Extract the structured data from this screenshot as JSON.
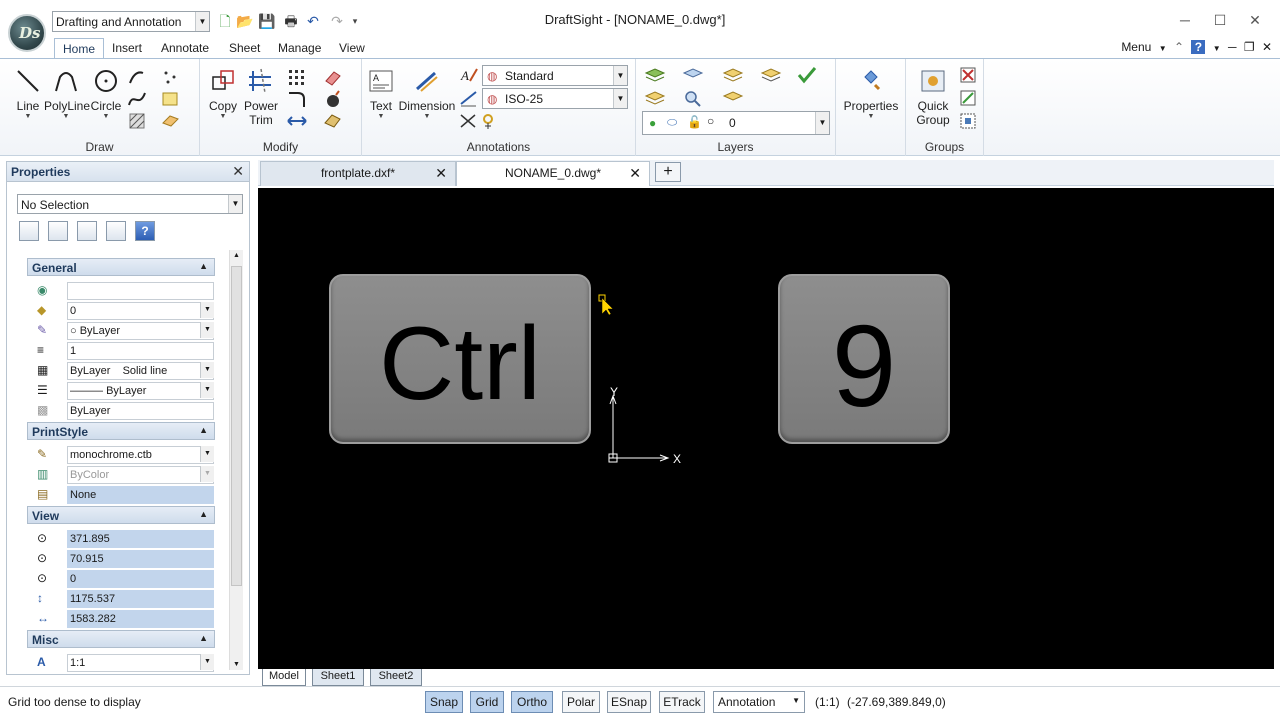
{
  "app": {
    "logo_text": "Ds",
    "title": "DraftSight - [NONAME_0.dwg*]"
  },
  "workspace": {
    "value": "Drafting and Annotation"
  },
  "ribbon_tabs": [
    "Home",
    "Insert",
    "Annotate",
    "Sheet",
    "Manage",
    "View"
  ],
  "menu_label": "Menu",
  "draw": {
    "group": "Draw",
    "line": "Line",
    "polyline": "PolyLine",
    "circle": "Circle"
  },
  "modify": {
    "group": "Modify",
    "copy": "Copy",
    "power": "Power",
    "trim": "Trim"
  },
  "annotations": {
    "group": "Annotations",
    "text": "Text",
    "dimension": "Dimension",
    "text_style": "Standard",
    "dim_style": "ISO-25"
  },
  "layers": {
    "group": "Layers",
    "current": "0"
  },
  "properties_btn": "Properties",
  "groups": {
    "group": "Groups",
    "quick": "Quick",
    "group_label": "Group"
  },
  "properties": {
    "title": "Properties",
    "selection": "No Selection",
    "sections": {
      "general": "General",
      "printstyle": "PrintStyle",
      "view": "View",
      "misc": "Misc"
    },
    "general": {
      "color": "",
      "layer": "0",
      "linetype": "ByLayer",
      "scale": "1",
      "linestyle_a": "ByLayer",
      "linestyle_b": "Solid line",
      "lineweight": "ByLayer",
      "transparency": "ByLayer"
    },
    "printstyle": {
      "table": "monochrome.ctb",
      "style": "ByColor",
      "attached": "None"
    },
    "view": {
      "cx": "371.895",
      "cy": "70.915",
      "cz": "0",
      "height": "1175.537",
      "width": "1583.282"
    },
    "misc": {
      "scale": "1:1"
    }
  },
  "doc_tabs": [
    {
      "label": "frontplate.dxf*"
    },
    {
      "label": "NONAME_0.dwg*"
    }
  ],
  "canvas": {
    "key1": "Ctrl",
    "key2": "9",
    "axis_x": "X",
    "axis_y": "Y"
  },
  "sheet_tabs": [
    "Model",
    "Sheet1",
    "Sheet2"
  ],
  "status": {
    "message": "Grid too dense to display",
    "toggles": [
      "Snap",
      "Grid",
      "Ortho",
      "Polar",
      "ESnap",
      "ETrack"
    ],
    "annotation": "Annotation",
    "scale": "(1:1)",
    "coords": "(-27.69,389.849,0)"
  },
  "colors": {
    "canvas_bg": "#000000",
    "accent": "#1f3a5c",
    "toggle_on": "#bcd3ee",
    "cursor": "#ffd400"
  }
}
